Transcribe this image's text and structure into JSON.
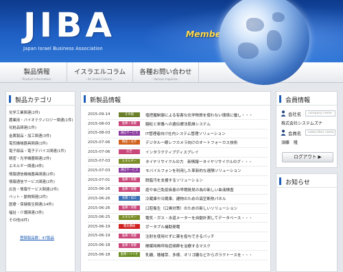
{
  "header": {
    "logo_text": "JIBA",
    "logo_subtitle": "Japan Israel Business Association",
    "tagline": "Member limited contents"
  },
  "nav": [
    {
      "label": "製品情報",
      "sub": "- Product Information -"
    },
    {
      "label": "イスラエルコラム",
      "sub": "- An Israel Column -"
    },
    {
      "label": "各種お問い合わせ",
      "sub": "- Various Inquiries -"
    }
  ],
  "categories": {
    "title": "製品カテゴリ",
    "items": [
      "化学工業関連(2件)",
      "農業用・バイオテクノロジー関連(1件)",
      "化粧品関連(1件)",
      "金属製品・加工関連(3件)",
      "電気機械器具関連(1件)",
      "電子部品・電子デバイス関連(1件)",
      "精密・光学機器関連(2件)",
      "エネルギー関連(4件)",
      "情報通信機械器具関連(2件)",
      "情報通信サービス関連(2件)",
      "広告・情報サービス関連(2件)",
      "ペット・動物関連(2件)",
      "医療・保健衛生関連(14件)",
      "福祉・介護関連(3件)",
      "その他(6件)"
    ],
    "total": "登録製品数：47製品"
  },
  "news": {
    "title": "新製品情報",
    "rows": [
      {
        "date": "2015-09-14",
        "tag": "その他",
        "color": "#6b7f2a",
        "title": "塩把握制御による有害な化学物質を使わない環境に優し・・・"
      },
      {
        "date": "2015-08-03",
        "tag": "医療 / 保健",
        "color": "#c9467a",
        "title": "腸粒と栄養への遺伝療法肌維システム"
      },
      {
        "date": "2015-08-03",
        "tag": "通信サービス",
        "color": "#8a3a9e",
        "title": "IT管理者向け社内システム管理ソリューション"
      },
      {
        "date": "2015-07-06",
        "tag": "精密 / 光学",
        "color": "#d0611c",
        "title": "デジタル一眼レフカメラ向けのオートフォーカス技術"
      },
      {
        "date": "2015-07-06",
        "tag": "広告",
        "color": "#c9467a",
        "title": "インタラクティブディスプレイ"
      },
      {
        "date": "2015-07-03",
        "tag": "エネルギー",
        "color": "#7a8d26",
        "title": "タイヤリサイクルの力　新情報ータイヤリサイクルのグ・・・"
      },
      {
        "date": "2015-07-03",
        "tag": "通信サービス",
        "color": "#8a3a9e",
        "title": "モバイルフォンを利用した革新的な遠隔ソリューション"
      },
      {
        "date": "2015-07-01",
        "tag": "医療 / 保健",
        "color": "#c9467a",
        "title": "脱脂汚を支援するソリューション"
      },
      {
        "date": "2015-06-26",
        "tag": "医療 / 保健",
        "color": "#c9467a",
        "title": "癌や自己免疫疾患の早期発見の為の新しい血液検査"
      },
      {
        "date": "2015-06-26",
        "tag": "金属 / 加工",
        "color": "#3a6fb5",
        "title": "冷蔵庫や冷蔵車、建物のための高空断熱パネル"
      },
      {
        "date": "2015-06-26",
        "tag": "医療 / 保健",
        "color": "#c9467a",
        "title": "口腔衛生（口臭対策）のための新しいソリューション"
      },
      {
        "date": "2015-06-25",
        "tag": "エネルギー",
        "color": "#7a8d26",
        "title": "電気・ガス・水道メーターを自動計測してデータベース・・・"
      },
      {
        "date": "2015-06-19",
        "tag": "電気機械",
        "color": "#d02020",
        "title": "ポータブル補助発電"
      },
      {
        "date": "2015-06-19",
        "tag": "医療 / 保健",
        "color": "#c9467a",
        "title": "注射を使用せずに薬を投与できるパッチ"
      },
      {
        "date": "2015-06-18",
        "tag": "医療 / 保健",
        "color": "#c9467a",
        "title": "睡眠時無呼吸症候群を治療するマスク"
      },
      {
        "date": "2015-06-18",
        "tag": "医療 / バイオ",
        "color": "#6b8e23",
        "title": "乳糖、穂椿芽、多様、オリゴ糖などからガラクトースを・・・"
      }
    ]
  },
  "member": {
    "title": "会員情報",
    "company_label": "会社名",
    "company_placeholder": "company name",
    "company_value": "株式会社システムズナ",
    "member_label": "会員名",
    "member_placeholder": "subscriber name",
    "member_value": "須藤　隆",
    "logout_label": "ログアウト ▶",
    "notice_title": "お知らせ"
  }
}
